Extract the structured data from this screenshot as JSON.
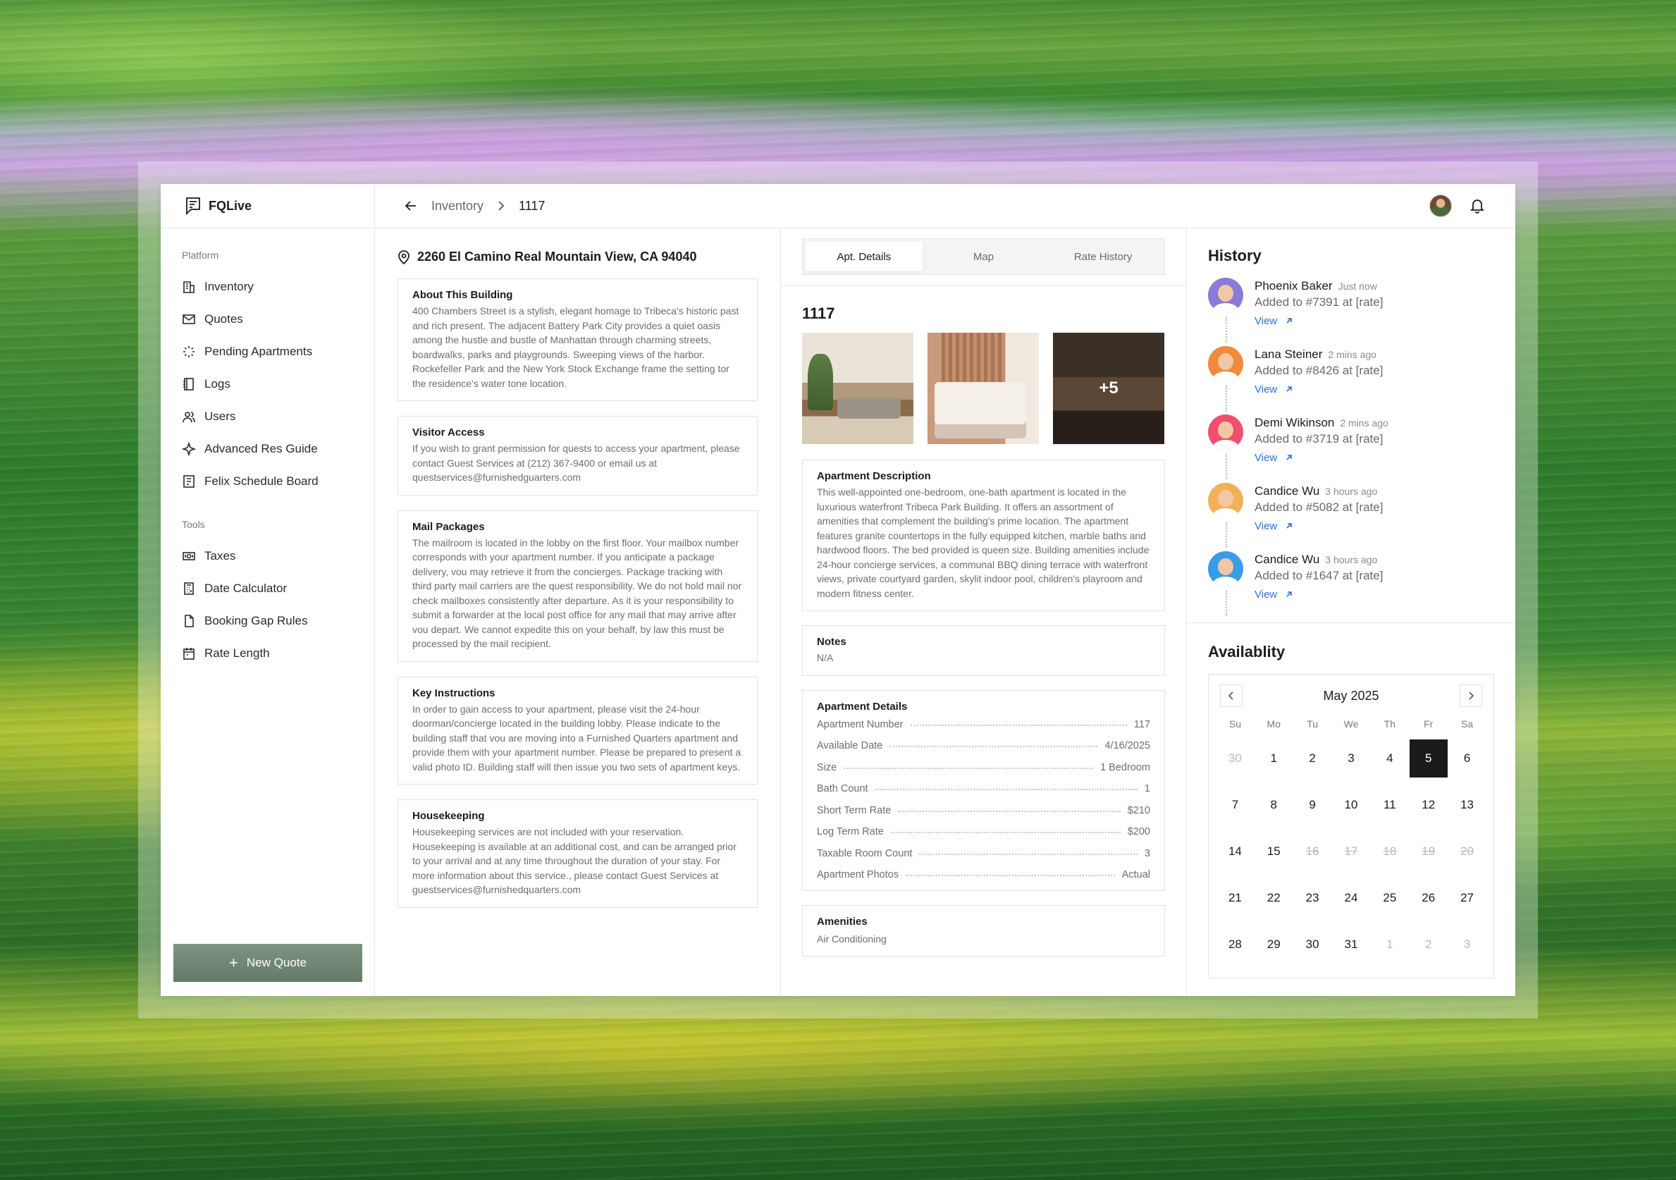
{
  "app": {
    "name": "FQLive"
  },
  "breadcrumb": {
    "parent": "Inventory",
    "current": "1117"
  },
  "sidebar": {
    "platform_label": "Platform",
    "platform_items": [
      {
        "label": "Inventory",
        "icon": "building-icon"
      },
      {
        "label": "Quotes",
        "icon": "mail-icon"
      },
      {
        "label": "Pending Apartments",
        "icon": "loader-icon"
      },
      {
        "label": "Logs",
        "icon": "notebook-icon"
      },
      {
        "label": "Users",
        "icon": "users-icon"
      },
      {
        "label": "Advanced Res Guide",
        "icon": "sparkle-icon"
      },
      {
        "label": "Felix Schedule Board",
        "icon": "board-icon"
      }
    ],
    "tools_label": "Tools",
    "tools_items": [
      {
        "label": "Taxes",
        "icon": "money-icon"
      },
      {
        "label": "Date Calculator",
        "icon": "calculator-icon"
      },
      {
        "label": "Booking Gap Rules",
        "icon": "file-icon"
      },
      {
        "label": "Rate Length",
        "icon": "calendar-icon"
      }
    ],
    "new_quote": "New Quote"
  },
  "building": {
    "address": "2260 El Camino Real Mountain View, CA 94040",
    "cards": [
      {
        "title": "About This Building",
        "body": "400 Chambers Street is a stylish, elegant homage to Tribeca's historic past and rich present. The adjacent Battery Park City provides a quiet oasis among the hustle and bustle of Manhattan through charming streets, boardwalks, parks and playgrounds. Sweeping views of the harbor. Rockefeller Park and the New York Stock Exchange frame the setting tor the residence's water tone location."
      },
      {
        "title": "Visitor Access",
        "body": "If you wish to grant permission for quests to access your apartment, please contact Guest Services at (212) 367-9400 or email us at questservices@furnishedguarters.com"
      },
      {
        "title": "Mail Packages",
        "body": "The mailroom is located in the lobby on the first floor. Your mailbox number corresponds with your apartment number. If you anticipate a package delivery, vou may retrieve it from the concierges. Package tracking with third party mail carriers are the quest responsibility. We do not hold mail nor check mailboxes consistently after departure. As it is your responsibility to submit a forwarder at the local post office for any mail that may arrive after vou depart. We cannot expedite this on your behalf, by law this must be processed by the mail recipient."
      },
      {
        "title": "Key Instructions",
        "body": "In order to gain access to your apartment, please visit the 24-hour doorman/concierge located in the building lobby. Please indicate to the building staff that vou are moving into a Furnished Quarters apartment and provide them with your apartment number. Please be prepared to present a valid photo ID. Building staff will then issue you two sets of apartment keys."
      },
      {
        "title": "Housekeeping",
        "body": "Housekeeping services are not included with your reservation. Housekeeping is available at an additional cost, and can be arranged prior to your arrival and at any time throughout the duration of your stay. For more information about this service., please contact Guest Services at guestservices@furnishedquarters.com"
      }
    ]
  },
  "apartment": {
    "tabs": [
      "Apt. Details",
      "Map",
      "Rate History"
    ],
    "number": "1117",
    "photos_more": "+5",
    "description_title": "Apartment Description",
    "description": "This well-appointed one-bedroom, one-bath apartment is located in the luxurious waterfront Tribeca Park Building. It offers an assortment of amenities that complement the building's prime location. The apartment features granite countertops in the fully equipped kitchen, marble baths and hardwood floors. The bed provided is queen size. Building amenities include 24-hour concierge services, a communal BBQ dining terrace with waterfront views, private courtyard garden, skylit indoor pool, children's playroom and modern fitness center.",
    "notes_title": "Notes",
    "notes": "N/A",
    "details_title": "Apartment Details",
    "details": [
      {
        "label": "Apartment Number",
        "value": "117"
      },
      {
        "label": "Available Date",
        "value": "4/16/2025"
      },
      {
        "label": "Size",
        "value": "1 Bedroom"
      },
      {
        "label": "Bath Count",
        "value": "1"
      },
      {
        "label": "Short Term Rate",
        "value": "$210"
      },
      {
        "label": "Log Term Rate",
        "value": "$200"
      },
      {
        "label": "Taxable Room Count",
        "value": "3"
      },
      {
        "label": "Apartment Photos",
        "value": "Actual"
      }
    ],
    "amenities_title": "Amenities",
    "amenities": [
      "Air Conditioning"
    ]
  },
  "history": {
    "title": "History",
    "view_label": "View",
    "items": [
      {
        "name": "Phoenix Baker",
        "time": "Just now",
        "action": "Added to #7391 at [rate]",
        "color": "#8a7bd6"
      },
      {
        "name": "Lana Steiner",
        "time": "2 mins ago",
        "action": "Added to #8426 at [rate]",
        "color": "#f08a3c"
      },
      {
        "name": "Demi Wikinson",
        "time": "2 mins ago",
        "action": "Added to #3719 at [rate]",
        "color": "#f0506e"
      },
      {
        "name": "Candice Wu",
        "time": "3 hours ago",
        "action": "Added to #5082 at [rate]",
        "color": "#f2b05a"
      },
      {
        "name": "Candice Wu",
        "time": "3 hours ago",
        "action": "Added to #1647 at [rate]",
        "color": "#3a9ce6"
      }
    ]
  },
  "availability": {
    "title": "Availablity",
    "month": "May 2025",
    "dow": [
      "Su",
      "Mo",
      "Tu",
      "We",
      "Th",
      "Fr",
      "Sa"
    ],
    "days": [
      {
        "d": "30",
        "s": "other"
      },
      {
        "d": "1",
        "s": ""
      },
      {
        "d": "2",
        "s": ""
      },
      {
        "d": "3",
        "s": ""
      },
      {
        "d": "4",
        "s": ""
      },
      {
        "d": "5",
        "s": "sel"
      },
      {
        "d": "6",
        "s": ""
      },
      {
        "d": "7",
        "s": ""
      },
      {
        "d": "8",
        "s": ""
      },
      {
        "d": "9",
        "s": ""
      },
      {
        "d": "10",
        "s": ""
      },
      {
        "d": "11",
        "s": ""
      },
      {
        "d": "12",
        "s": ""
      },
      {
        "d": "13",
        "s": ""
      },
      {
        "d": "14",
        "s": ""
      },
      {
        "d": "15",
        "s": ""
      },
      {
        "d": "16",
        "s": "strike"
      },
      {
        "d": "17",
        "s": "strike"
      },
      {
        "d": "18",
        "s": "strike"
      },
      {
        "d": "19",
        "s": "strike"
      },
      {
        "d": "20",
        "s": "strike"
      },
      {
        "d": "21",
        "s": ""
      },
      {
        "d": "22",
        "s": ""
      },
      {
        "d": "23",
        "s": ""
      },
      {
        "d": "24",
        "s": ""
      },
      {
        "d": "25",
        "s": ""
      },
      {
        "d": "26",
        "s": ""
      },
      {
        "d": "27",
        "s": ""
      },
      {
        "d": "28",
        "s": ""
      },
      {
        "d": "29",
        "s": ""
      },
      {
        "d": "30",
        "s": ""
      },
      {
        "d": "31",
        "s": ""
      },
      {
        "d": "1",
        "s": "other"
      },
      {
        "d": "2",
        "s": "other"
      },
      {
        "d": "3",
        "s": "other"
      }
    ]
  }
}
